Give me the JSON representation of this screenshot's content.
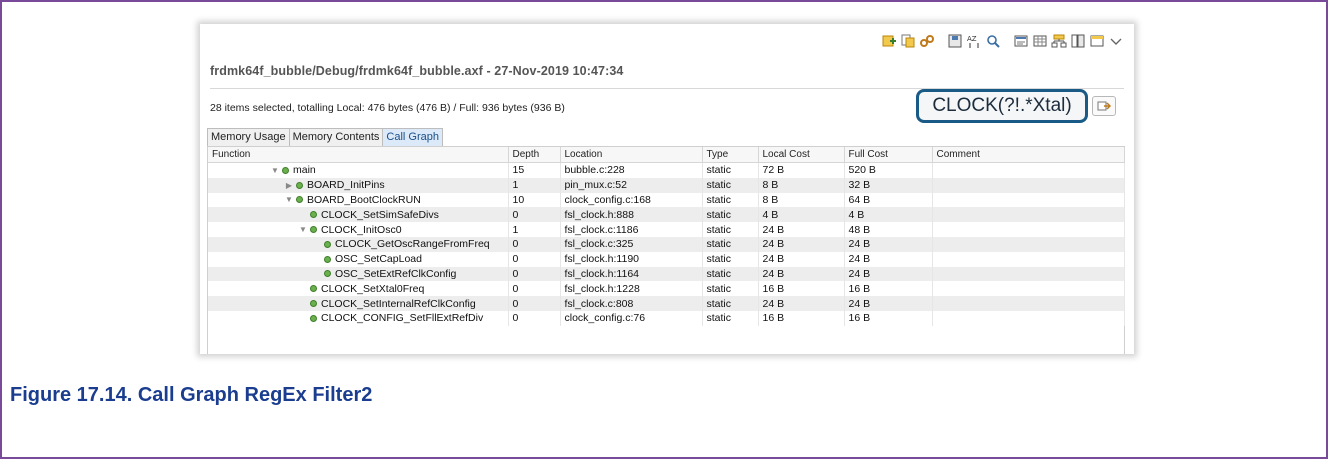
{
  "toolbar": {
    "icons": [
      "add-icon",
      "copy-icon",
      "link-icon",
      "save-icon",
      "sort-icon",
      "search-icon",
      "view-icon",
      "grid-icon",
      "tree-icon",
      "columns-icon",
      "panel-icon",
      "menu-chevron-icon"
    ]
  },
  "header": {
    "path_title": "frdmk64f_bubble/Debug/frdmk64f_bubble.axf - 27-Nov-2019 10:47:34",
    "summary": "28 items selected, totalling Local: 476 bytes (476 B) / Full: 936 bytes (936 B)"
  },
  "filter": {
    "value": "CLOCK(?!.*Xtal)"
  },
  "tabs": [
    {
      "label": "Memory Usage"
    },
    {
      "label": "Memory Contents"
    },
    {
      "label": "Call Graph"
    }
  ],
  "table": {
    "columns": [
      "Function",
      "Depth",
      "Location",
      "Type",
      "Local Cost",
      "Full Cost",
      "Comment"
    ],
    "rows": [
      {
        "fn": "main",
        "indent": 0,
        "twisty": "open",
        "depth": "15",
        "location": "bubble.c:228",
        "type": "static",
        "local": "72 B",
        "full": "520 B",
        "comment": ""
      },
      {
        "fn": "BOARD_InitPins",
        "indent": 1,
        "twisty": "closed",
        "depth": "1",
        "location": "pin_mux.c:52",
        "type": "static",
        "local": "8 B",
        "full": "32 B",
        "comment": ""
      },
      {
        "fn": "BOARD_BootClockRUN",
        "indent": 1,
        "twisty": "open",
        "depth": "10",
        "location": "clock_config.c:168",
        "type": "static",
        "local": "8 B",
        "full": "64 B",
        "comment": ""
      },
      {
        "fn": "CLOCK_SetSimSafeDivs",
        "indent": 2,
        "twisty": "none",
        "depth": "0",
        "location": "fsl_clock.h:888",
        "type": "static",
        "local": "4 B",
        "full": "4 B",
        "comment": ""
      },
      {
        "fn": "CLOCK_InitOsc0",
        "indent": 2,
        "twisty": "open",
        "depth": "1",
        "location": "fsl_clock.c:1186",
        "type": "static",
        "local": "24 B",
        "full": "48 B",
        "comment": ""
      },
      {
        "fn": "CLOCK_GetOscRangeFromFreq",
        "indent": 3,
        "twisty": "none",
        "depth": "0",
        "location": "fsl_clock.c:325",
        "type": "static",
        "local": "24 B",
        "full": "24 B",
        "comment": ""
      },
      {
        "fn": "OSC_SetCapLoad",
        "indent": 3,
        "twisty": "none",
        "depth": "0",
        "location": "fsl_clock.h:1190",
        "type": "static",
        "local": "24 B",
        "full": "24 B",
        "comment": ""
      },
      {
        "fn": "OSC_SetExtRefClkConfig",
        "indent": 3,
        "twisty": "none",
        "depth": "0",
        "location": "fsl_clock.h:1164",
        "type": "static",
        "local": "24 B",
        "full": "24 B",
        "comment": ""
      },
      {
        "fn": "CLOCK_SetXtal0Freq",
        "indent": 2,
        "twisty": "none",
        "depth": "0",
        "location": "fsl_clock.h:1228",
        "type": "static",
        "local": "16 B",
        "full": "16 B",
        "comment": ""
      },
      {
        "fn": "CLOCK_SetInternalRefClkConfig",
        "indent": 2,
        "twisty": "none",
        "depth": "0",
        "location": "fsl_clock.c:808",
        "type": "static",
        "local": "24 B",
        "full": "24 B",
        "comment": ""
      },
      {
        "fn": "CLOCK_CONFIG_SetFllExtRefDiv",
        "indent": 2,
        "twisty": "none",
        "depth": "0",
        "location": "clock_config.c:76",
        "type": "static",
        "local": "16 B",
        "full": "16 B",
        "comment": ""
      }
    ]
  },
  "caption": "Figure 17.14. Call Graph RegEx Filter2"
}
